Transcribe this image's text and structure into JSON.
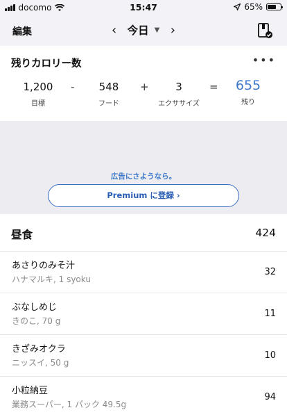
{
  "status": {
    "carrier": "docomo",
    "time": "15:47",
    "battery": "65%"
  },
  "nav": {
    "edit_label": "編集",
    "date_label": "今日",
    "prev_arrow": "‹",
    "next_arrow": "›",
    "caret": "▼"
  },
  "calories": {
    "title": "残りカロリー数",
    "more": "•••",
    "goal_value": "1,200",
    "goal_label": "目標",
    "op_minus": "-",
    "food_value": "548",
    "food_label": "フード",
    "op_plus": "+",
    "exercise_value": "3",
    "exercise_label": "エクササイズ",
    "op_equals": "=",
    "remaining_value": "655",
    "remaining_label": "残り",
    "remaining_color": "#3e79c9"
  },
  "ad": {
    "text": "広告にさようなら。",
    "premium_label": "Premium に登録 ›"
  },
  "meal": {
    "title": "昼食",
    "total": "424",
    "items": [
      {
        "name": "あさりのみそ汁",
        "detail": "ハナマルキ, 1 syoku",
        "calories": "32"
      },
      {
        "name": "ぶなしめじ",
        "detail": "きのこ, 70 g",
        "calories": "11"
      },
      {
        "name": "きざみオクラ",
        "detail": "ニッスイ, 50 g",
        "calories": "10"
      },
      {
        "name": "小粒納豆",
        "detail": "業務スーパー, 1 パック 49.5g",
        "calories": "94"
      }
    ]
  }
}
